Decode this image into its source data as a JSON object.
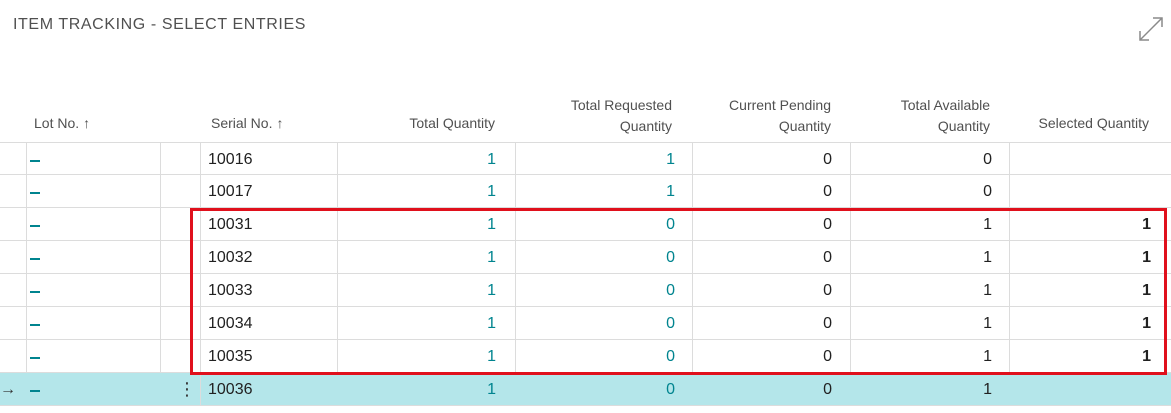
{
  "page": {
    "title": "ITEM TRACKING - SELECT ENTRIES",
    "expand_icon": "expand-icon"
  },
  "columns": {
    "lot_no": "Lot No.",
    "lot_sort": "↑",
    "serial_no": "Serial No.",
    "serial_sort": "↑",
    "total_quantity": "Total Quantity",
    "total_requested_1": "Total Requested",
    "total_requested_2": "Quantity",
    "current_pending_1": "Current Pending",
    "current_pending_2": "Quantity",
    "total_available_1": "Total Available",
    "total_available_2": "Quantity",
    "selected_quantity": "Selected Quantity"
  },
  "rows": [
    {
      "lot": "_",
      "serial": "10016",
      "total": "1",
      "requested": "1",
      "pending": "0",
      "available": "0",
      "selected": ""
    },
    {
      "lot": "_",
      "serial": "10017",
      "total": "1",
      "requested": "1",
      "pending": "0",
      "available": "0",
      "selected": ""
    },
    {
      "lot": "_",
      "serial": "10031",
      "total": "1",
      "requested": "0",
      "pending": "0",
      "available": "1",
      "selected": "1"
    },
    {
      "lot": "_",
      "serial": "10032",
      "total": "1",
      "requested": "0",
      "pending": "0",
      "available": "1",
      "selected": "1"
    },
    {
      "lot": "_",
      "serial": "10033",
      "total": "1",
      "requested": "0",
      "pending": "0",
      "available": "1",
      "selected": "1"
    },
    {
      "lot": "_",
      "serial": "10034",
      "total": "1",
      "requested": "0",
      "pending": "0",
      "available": "1",
      "selected": "1"
    },
    {
      "lot": "_",
      "serial": "10035",
      "total": "1",
      "requested": "0",
      "pending": "0",
      "available": "1",
      "selected": "1"
    },
    {
      "lot": "_",
      "serial": "10036",
      "total": "1",
      "requested": "0",
      "pending": "0",
      "available": "1",
      "selected": ""
    }
  ],
  "current_row_marker": "→",
  "row_menu_glyph": "⋮",
  "colors": {
    "accent": "#00848f",
    "current_row": "#b4e6ea",
    "highlight": "#e0101c"
  }
}
